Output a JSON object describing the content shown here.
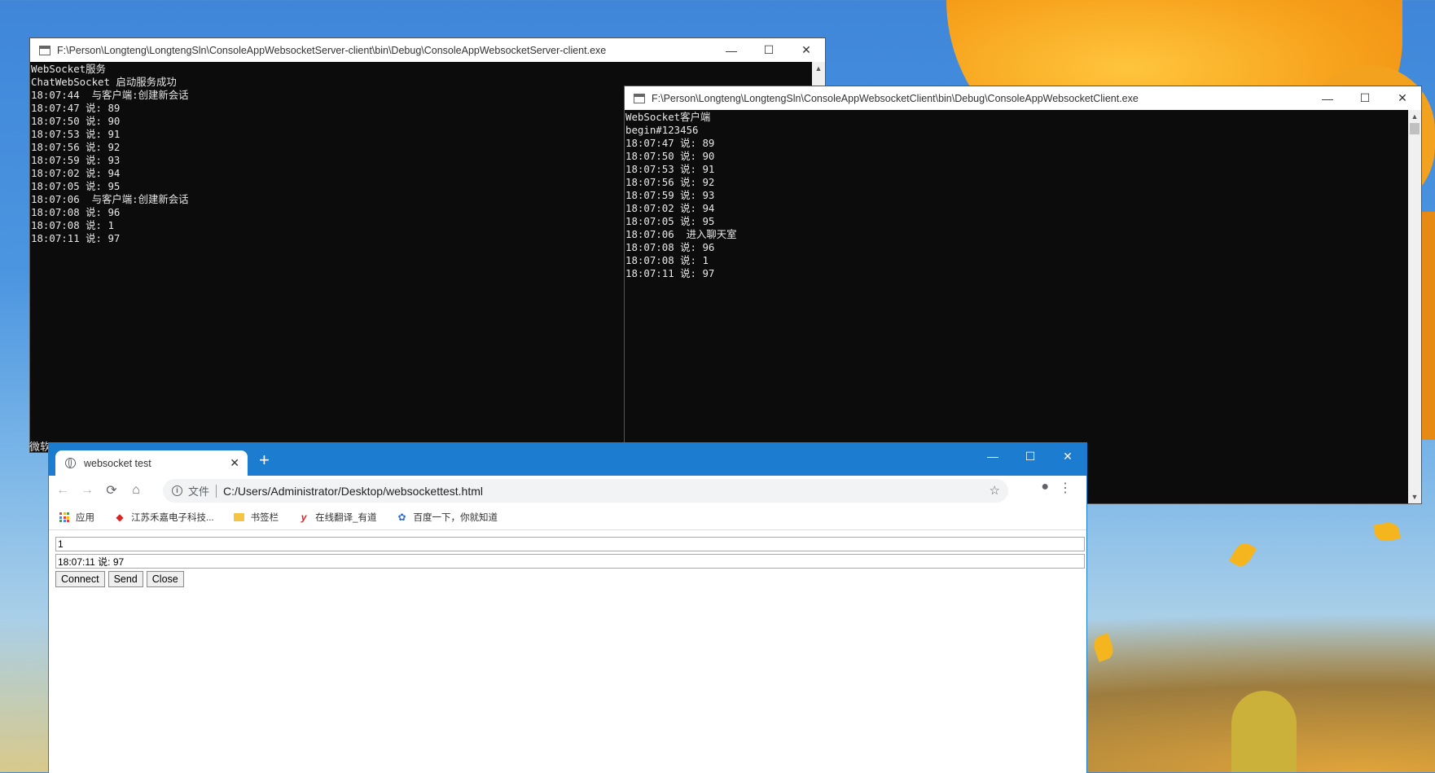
{
  "server_window": {
    "title": "F:\\Person\\Longteng\\LongtengSln\\ConsoleAppWebsocketServer-client\\bin\\Debug\\ConsoleAppWebsocketServer-client.exe",
    "lines": [
      "WebSocket服务",
      "ChatWebSocket 启动服务成功",
      "18:07:44  与客户端:创建新会话",
      "18:07:47 说: 89",
      "18:07:50 说: 90",
      "18:07:53 说: 91",
      "18:07:56 说: 92",
      "18:07:59 说: 93",
      "18:07:02 说: 94",
      "18:07:05 说: 95",
      "18:07:06  与客户端:创建新会话",
      "18:07:08 说: 96",
      "18:07:08 说: 1",
      "18:07:11 说: 97"
    ],
    "bottom_text": "微软"
  },
  "client_window": {
    "title": "F:\\Person\\Longteng\\LongtengSln\\ConsoleAppWebsocketClient\\bin\\Debug\\ConsoleAppWebsocketClient.exe",
    "lines": [
      "WebSocket客户端",
      "begin#123456",
      "18:07:47 说: 89",
      "18:07:50 说: 90",
      "18:07:53 说: 91",
      "18:07:56 说: 92",
      "18:07:59 说: 93",
      "18:07:02 说: 94",
      "18:07:05 说: 95",
      "18:07:06  进入聊天室",
      "18:07:08 说: 96",
      "18:07:08 说: 1",
      "18:07:11 说: 97"
    ]
  },
  "window_controls": {
    "minimize": "—",
    "maximize": "☐",
    "close": "✕"
  },
  "browser": {
    "tab_title": "websocket test",
    "tab_close": "✕",
    "new_tab": "+",
    "address_scheme": "文件",
    "address_url": "C:/Users/Administrator/Desktop/websockettest.html",
    "bookmarks": [
      {
        "label": "应用",
        "icon": "apps-grid-icon"
      },
      {
        "label": "江苏禾嘉电子科技...",
        "icon": "jiangsu-site-icon"
      },
      {
        "label": "书签栏",
        "icon": "folder-icon"
      },
      {
        "label": "在线翻译_有道",
        "icon": "youdao-icon"
      },
      {
        "label": "百度一下，你就知道",
        "icon": "baidu-paw-icon"
      }
    ],
    "page": {
      "input_value": "1",
      "message_value": "18:07:11 说: 97",
      "connect_label": "Connect",
      "send_label": "Send",
      "close_label": "Close"
    }
  },
  "colors": {
    "console_bg": "#0c0c0c",
    "console_text": "#e8e8e8",
    "chrome_frame": "#1c7ccf"
  }
}
